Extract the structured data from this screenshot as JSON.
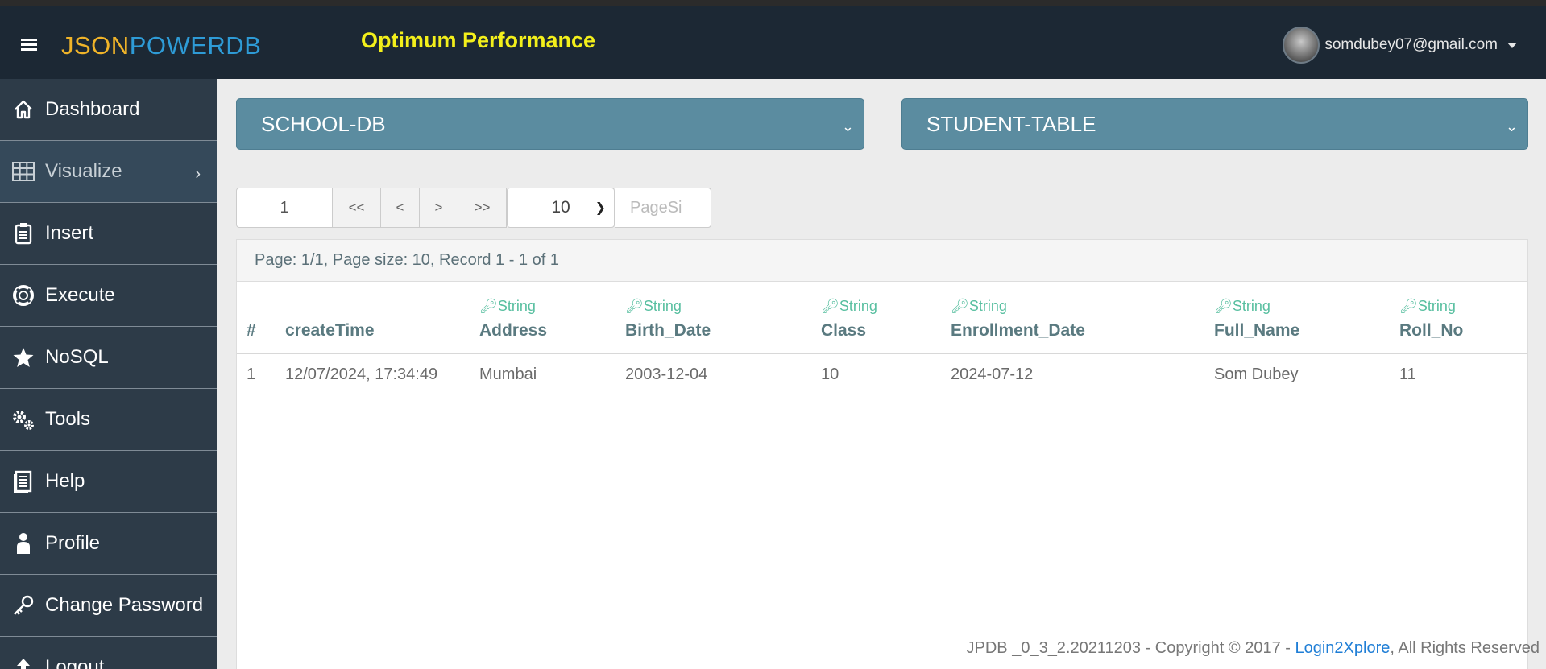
{
  "header": {
    "logo_part1": "JSON",
    "logo_part2": "POWERDB",
    "tagline": "Optimum Performance",
    "user_email": "somdubey07@gmail.com"
  },
  "sidebar": {
    "items": [
      {
        "label": "Dashboard",
        "icon": "home-icon"
      },
      {
        "label": "Visualize",
        "icon": "grid-icon"
      },
      {
        "label": "Insert",
        "icon": "clipboard-icon"
      },
      {
        "label": "Execute",
        "icon": "life-ring-icon"
      },
      {
        "label": "NoSQL",
        "icon": "star-icon"
      },
      {
        "label": "Tools",
        "icon": "gears-icon"
      },
      {
        "label": "Help",
        "icon": "book-icon"
      },
      {
        "label": "Profile",
        "icon": "user-icon"
      },
      {
        "label": "Change Password",
        "icon": "key-icon"
      },
      {
        "label": "Logout",
        "icon": "upload-icon"
      }
    ]
  },
  "selectors": {
    "database": "SCHOOL-DB",
    "table": "STUDENT-TABLE"
  },
  "pager": {
    "page": "1",
    "first": "<<",
    "prev": "<",
    "next": ">",
    "last": ">>",
    "page_size": "10",
    "page_size_placeholder": "PageSi"
  },
  "info": "Page: 1/1, Page size: 10, Record 1 - 1 of 1",
  "table": {
    "columns": [
      {
        "type": "",
        "name": "#"
      },
      {
        "type": "",
        "name": "createTime"
      },
      {
        "type": "String",
        "name": "Address"
      },
      {
        "type": "String",
        "name": "Birth_Date"
      },
      {
        "type": "String",
        "name": "Class"
      },
      {
        "type": "String",
        "name": "Enrollment_Date"
      },
      {
        "type": "String",
        "name": "Full_Name"
      },
      {
        "type": "String",
        "name": "Roll_No"
      }
    ],
    "rows": [
      [
        "1",
        "12/07/2024, 17:34:49",
        "Mumbai",
        "2003-12-04",
        "10",
        "2024-07-12",
        "Som Dubey",
        "11"
      ]
    ]
  },
  "footer": {
    "text_before": "JPDB _0_3_2.20211203 - Copyright © 2017 - ",
    "link": "Login2Xplore",
    "text_after": ", All Rights Reserved"
  }
}
